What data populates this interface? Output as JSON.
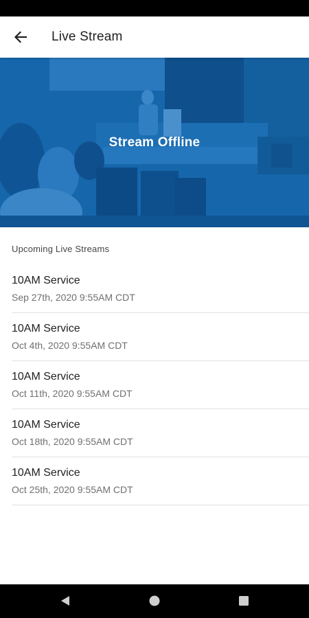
{
  "app_bar": {
    "title": "Live Stream",
    "back_icon": "arrow-left-icon"
  },
  "hero": {
    "status_text": "Stream Offline",
    "overlay_color": "#1565a8"
  },
  "section": {
    "label": "Upcoming Live Streams"
  },
  "streams": [
    {
      "title": "10AM Service",
      "datetime": "Sep 27th, 2020 9:55AM CDT"
    },
    {
      "title": "10AM Service",
      "datetime": "Oct 4th, 2020 9:55AM CDT"
    },
    {
      "title": "10AM Service",
      "datetime": "Oct 11th, 2020 9:55AM CDT"
    },
    {
      "title": "10AM Service",
      "datetime": "Oct 18th, 2020 9:55AM CDT"
    },
    {
      "title": "10AM Service",
      "datetime": "Oct 25th, 2020 9:55AM CDT"
    }
  ],
  "nav_bar": {
    "back_icon": "triangle-back-icon",
    "home_icon": "circle-home-icon",
    "recents_icon": "square-recents-icon"
  }
}
